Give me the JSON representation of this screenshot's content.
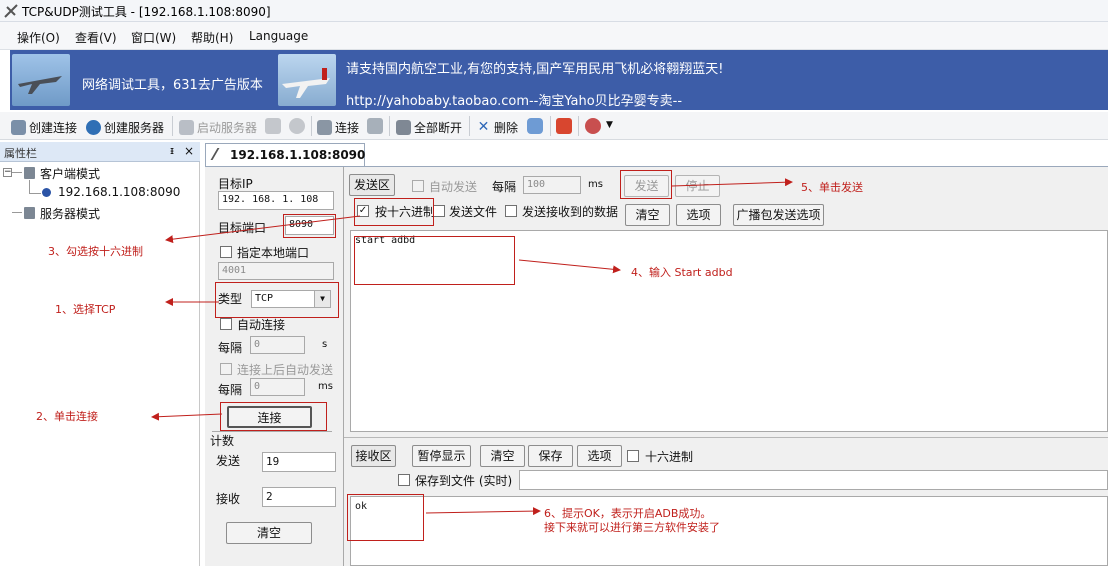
{
  "window": {
    "title": "TCP&UDP测试工具 - [192.168.1.108:8090]"
  },
  "menu": [
    "操作(O)",
    "查看(V)",
    "窗口(W)",
    "帮助(H)",
    "Language"
  ],
  "banner": {
    "left_text": "网络调试工具，631去广告版本",
    "right_line1": "请支持国内航空工业,有您的支持,国产军用民用飞机必将翱翔蓝天!",
    "right_line2": "http://yahobaby.taobao.com--淘宝Yaho贝比孕婴专卖--"
  },
  "toolbar": {
    "create_connection": "创建连接",
    "create_server": "创建服务器",
    "start_server": "启动服务器",
    "connect": "连接",
    "disconnect_all": "全部断开",
    "delete": "删除"
  },
  "sidebar": {
    "header": "属性栏",
    "pin": "ㅍ",
    "close": "×",
    "client_mode": "客户端模式",
    "connection_item": "192.168.1.108:8090",
    "server_mode": "服务器模式"
  },
  "tab": {
    "label": "192.168.1.108:8090"
  },
  "config": {
    "target_ip_label": "目标IP",
    "target_ip": "192. 168. 1. 108",
    "target_port_label": "目标端口",
    "target_port": "8090",
    "local_port_check_label": "指定本地端口",
    "local_port": "4001",
    "type_label": "类型",
    "type_value": "TCP",
    "auto_connect_label": "自动连接",
    "interval_label": "每隔",
    "interval_value": "0",
    "interval_unit_s": "s",
    "auto_send_after_connect_label": "连接上后自动发送",
    "interval2_value": "0",
    "interval_unit_ms": "ms",
    "connect_button": "连接"
  },
  "counter": {
    "title": "计数",
    "send_label": "发送",
    "send_value": "19",
    "recv_label": "接收",
    "recv_value": "2",
    "clear_button": "清空"
  },
  "send": {
    "area_label": "发送区",
    "auto_send_label": "自动发送",
    "interval_label": "每隔",
    "interval_value": "100",
    "interval_unit": "ms",
    "send_button": "发送",
    "stop_button": "停止",
    "hex_label": "按十六进制",
    "send_file_label": "发送文件",
    "send_received_label": "发送接收到的数据",
    "clear_button": "清空",
    "options_button": "选项",
    "broadcast_button": "广播包发送选项",
    "content": "start adbd"
  },
  "recv": {
    "area_label": "接收区",
    "pause_button": "暂停显示",
    "clear_button": "清空",
    "save_button": "保存",
    "options_button": "选项",
    "hex_label": "十六进制",
    "save_to_file_label": "保存到文件 (实时)",
    "content": "ok"
  },
  "annotations": {
    "step1": "1、选择TCP",
    "step2": "2、单击连接",
    "step3": "3、勾选按十六进制",
    "step4": "4、输入 Start adbd",
    "step5": "5、单击发送",
    "step6_line1": "6、提示OK，表示开启ADB成功。",
    "step6_line2": "接下来就可以进行第三方软件安装了"
  },
  "colors": {
    "annotation": "#c0201c",
    "banner_bg": "#3d5da8"
  }
}
